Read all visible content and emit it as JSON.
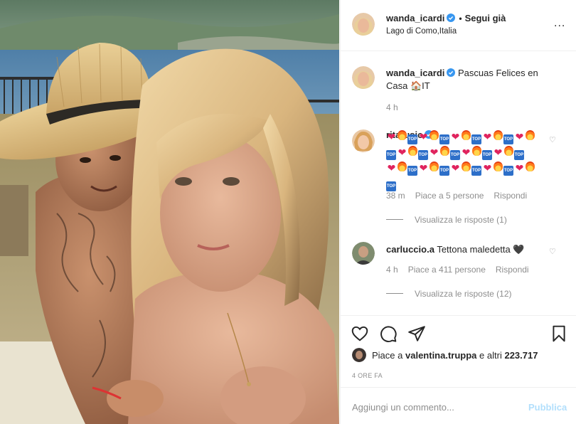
{
  "post": {
    "author": "wanda_icardi",
    "follow_label": "Segui già",
    "separator": "•",
    "location": "Lago di Como,Italia",
    "more_label": "..."
  },
  "caption": {
    "author": "wanda_icardi",
    "text_line1": "Pascuas Felices en",
    "text_line2": "Casa",
    "emoji_tail": "🏠IT",
    "time": "4 h"
  },
  "comments": [
    {
      "author": "ritarusic",
      "verified": true,
      "time": "38 m",
      "likes": "Piace a 5 persone",
      "reply": "Rispondi",
      "view_replies": "Visualizza le risposte (1)"
    },
    {
      "author": "carluccio.a",
      "verified": false,
      "text": "Tettona maledetta",
      "emoji": "🖤",
      "time": "4 h",
      "likes": "Piace a 411 persone",
      "reply": "Rispondi",
      "view_replies": "Visualizza le risposte (12)"
    }
  ],
  "emoji_pattern": [
    "heart",
    "fire",
    "top",
    "heart",
    "fire",
    "top",
    "heart",
    "fire",
    "top",
    "heart",
    "fire",
    "top",
    "heart",
    "fire",
    "top",
    "heart",
    "fire",
    "top",
    "heart",
    "fire",
    "top",
    "heart",
    "fire",
    "top",
    "heart",
    "fire",
    "top",
    "heart",
    "fire",
    "top",
    "heart",
    "fire",
    "top",
    "heart",
    "fire",
    "top",
    "heart",
    "fire",
    "top",
    "heart",
    "fire",
    "top"
  ],
  "emoji_top_text": "TOP",
  "likes_bar": {
    "prefix": "Piace a",
    "user": "valentina.truppa",
    "middle": "e altri",
    "count": "223.717"
  },
  "timestamp": "4 ORE FA",
  "comment_input": {
    "placeholder": "Aggiungi un commento...",
    "publish_label": "Pubblica"
  },
  "icons": {
    "like": "heart-outline-icon",
    "comment": "comment-bubble-icon",
    "share": "paper-plane-icon",
    "save": "bookmark-icon",
    "verified": "verified-badge-icon"
  },
  "colors": {
    "text": "#262626",
    "muted": "#8e8e8e",
    "verified": "#3897f0",
    "publish_disabled": "#b2dffc",
    "border": "#efefef"
  }
}
